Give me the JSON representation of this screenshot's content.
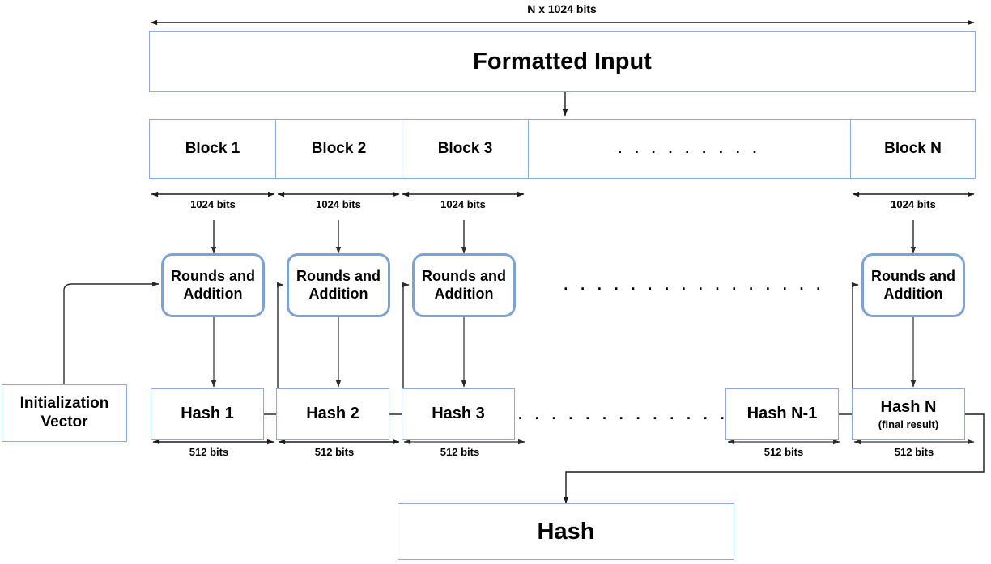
{
  "diagram": {
    "title_top_measure": "N x 1024 bits",
    "formatted_input": {
      "label": "Formatted Input"
    },
    "blocks": [
      {
        "label": "Block 1",
        "bits": "1024 bits"
      },
      {
        "label": "Block 2",
        "bits": "1024 bits"
      },
      {
        "label": "Block 3",
        "bits": "1024 bits"
      },
      {
        "label": "",
        "bits": ""
      },
      {
        "label": "Block N",
        "bits": "1024 bits"
      }
    ],
    "blocks_ellipsis": ". . . . . . . . .",
    "rounds": [
      {
        "label": "Rounds and Addition"
      },
      {
        "label": "Rounds and Addition"
      },
      {
        "label": "Rounds and Addition"
      },
      {
        "label": "Rounds and Addition"
      }
    ],
    "rounds_ellipsis": ". . . . . . . . . . . . . . . .",
    "initialization_vector": {
      "label": "Initialization Vector"
    },
    "hashes": [
      {
        "label": "Hash 1",
        "sub": "",
        "bits": "512 bits"
      },
      {
        "label": "Hash 2",
        "sub": "",
        "bits": "512 bits"
      },
      {
        "label": "Hash 3",
        "sub": "",
        "bits": "512 bits"
      },
      {
        "label": "Hash N-1",
        "sub": "",
        "bits": "512 bits"
      },
      {
        "label": "Hash N",
        "sub": "(final result)",
        "bits": "512 bits"
      }
    ],
    "hashes_ellipsis": ". . . . . . . . . . . . .",
    "final_hash": {
      "label": "Hash"
    },
    "colors": {
      "box_border": "#8faadc",
      "rounded_box_border": "#7fa2d4",
      "wire": "#1a1a1a",
      "wire_gray": "#595959",
      "text": "#000000",
      "background": "#ffffff"
    }
  }
}
